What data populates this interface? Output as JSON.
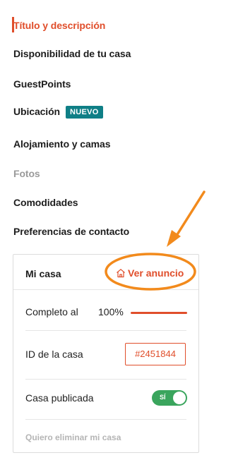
{
  "nav": {
    "items": [
      {
        "label": "Título y descripción"
      },
      {
        "label": "Disponibilidad de tu casa"
      },
      {
        "label": "GuestPoints"
      },
      {
        "label": "Ubicación",
        "badge": "NUEVO"
      },
      {
        "label": "Alojamiento y camas"
      },
      {
        "label": "Fotos"
      },
      {
        "label": "Comodidades"
      },
      {
        "label": "Preferencias de contacto"
      }
    ]
  },
  "card": {
    "title": "Mi casa",
    "view_link": "Ver anuncio",
    "complete_label": "Completo al",
    "complete_value": "100%",
    "complete_fraction": 1.0,
    "id_label": "ID de la casa",
    "id_value": "#2451844",
    "published_label": "Casa publicada",
    "toggle_text": "SÍ",
    "delete_link": "Quiero eliminar mi casa"
  },
  "colors": {
    "accent": "#e04e2b",
    "badge": "#0f7f86",
    "toggle_on": "#3aa55d",
    "annotation": "#f28a1c"
  }
}
